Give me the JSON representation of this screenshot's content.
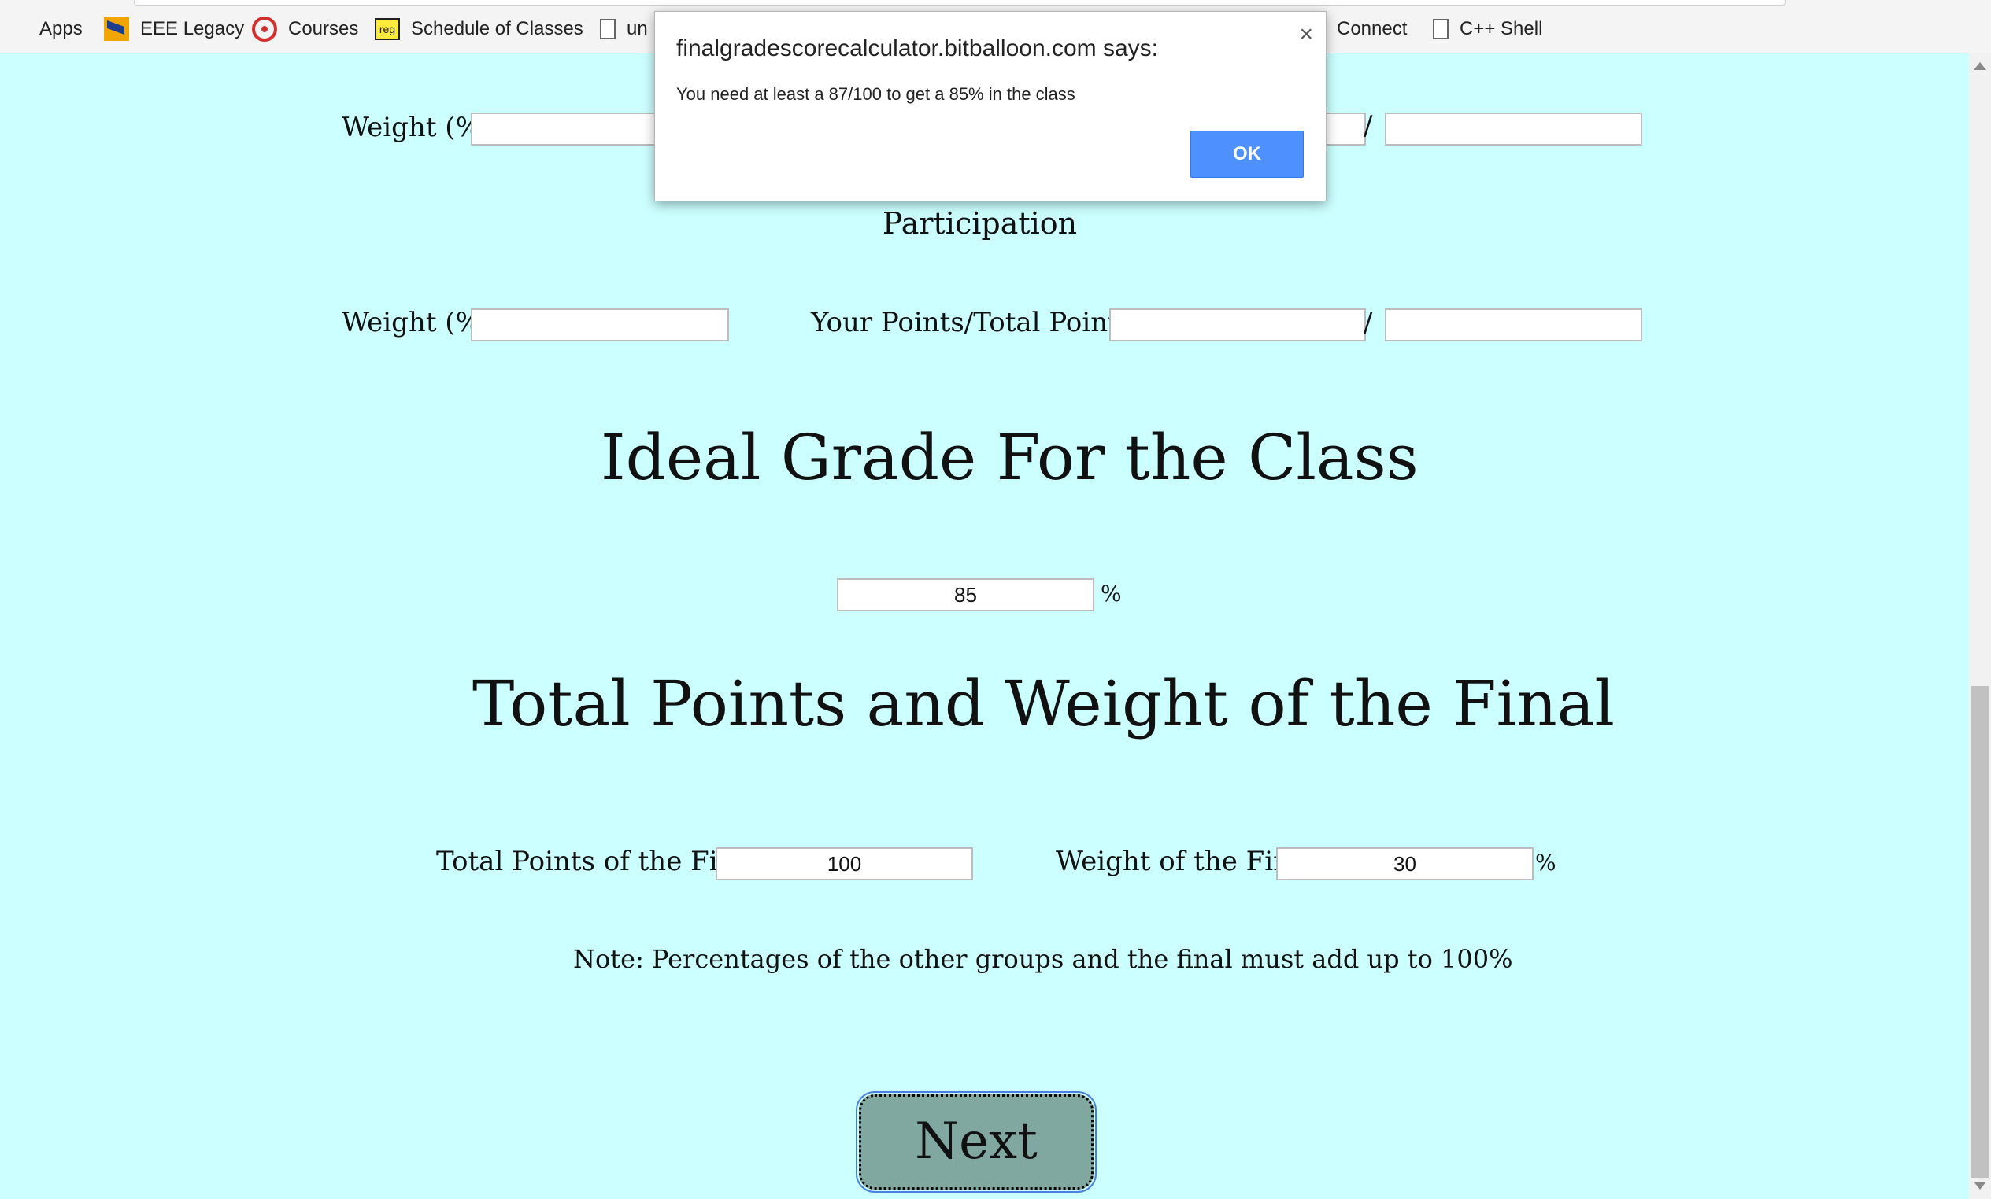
{
  "bookmarks": {
    "items": [
      {
        "label": "Apps"
      },
      {
        "label": "EEE Legacy"
      },
      {
        "label": "Courses"
      },
      {
        "label": "Schedule of Classes"
      },
      {
        "label": "un"
      },
      {
        "label": "Connect"
      },
      {
        "label": "C++ Shell"
      }
    ],
    "reg_icon_text": "reg"
  },
  "sections": {
    "first": {
      "weight_label": "Weight (%):",
      "weight_value": "",
      "your_points_value": "",
      "total_points_value": "",
      "slash": "/"
    },
    "participation": {
      "title": "Participation",
      "weight_label": "Weight (%):",
      "weight_value": "",
      "points_label": "Your Points/Total Points:",
      "your_points_value": "",
      "total_points_value": "",
      "slash": "/"
    }
  },
  "ideal": {
    "heading": "Ideal Grade For the Class",
    "value": "85",
    "unit": "%"
  },
  "final": {
    "heading": "Total Points and Weight of the Final",
    "points_label": "Total Points of the Final:",
    "points_value": "100",
    "weight_label": "Weight of the Final:",
    "weight_value": "30",
    "unit": "%"
  },
  "note": "Note: Percentages of the other groups and the final must add up to 100%",
  "next_button": "Next",
  "dialog": {
    "title": "finalgradescorecalculator.bitballoon.com says:",
    "message": "You need at least a 87/100 to get a 85% in the class",
    "ok_label": "OK",
    "close_glyph": "×"
  },
  "colors": {
    "page_background": "#ccffff",
    "next_button": "#80a8a0",
    "ok_button": "#4d90fe"
  }
}
